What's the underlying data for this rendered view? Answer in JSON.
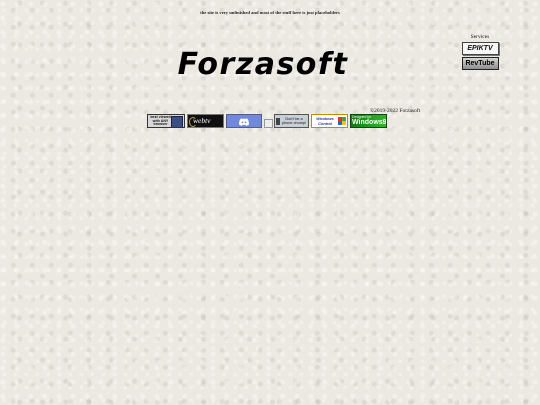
{
  "notice": "the site is very unfinished and most of the stuff here is just placeholders",
  "logo": {
    "text": "Forzasoft"
  },
  "services": {
    "heading": "Services",
    "items": [
      {
        "label": "EPIKTV"
      },
      {
        "label": "RevTube"
      }
    ]
  },
  "footer": {
    "copyright": "©2019-2022 Forzasoft",
    "buttons": {
      "best_viewed": "best viewed with ANY browser",
      "webtv": "webtv",
      "chump": "Don't be a phone chump!",
      "windows_central": "Windows Central",
      "win98_small": "Designed for",
      "win98_big": "Windows98"
    }
  },
  "colors": {
    "background": "#ece9e3",
    "text": "#222222",
    "discord": "#7289da"
  }
}
